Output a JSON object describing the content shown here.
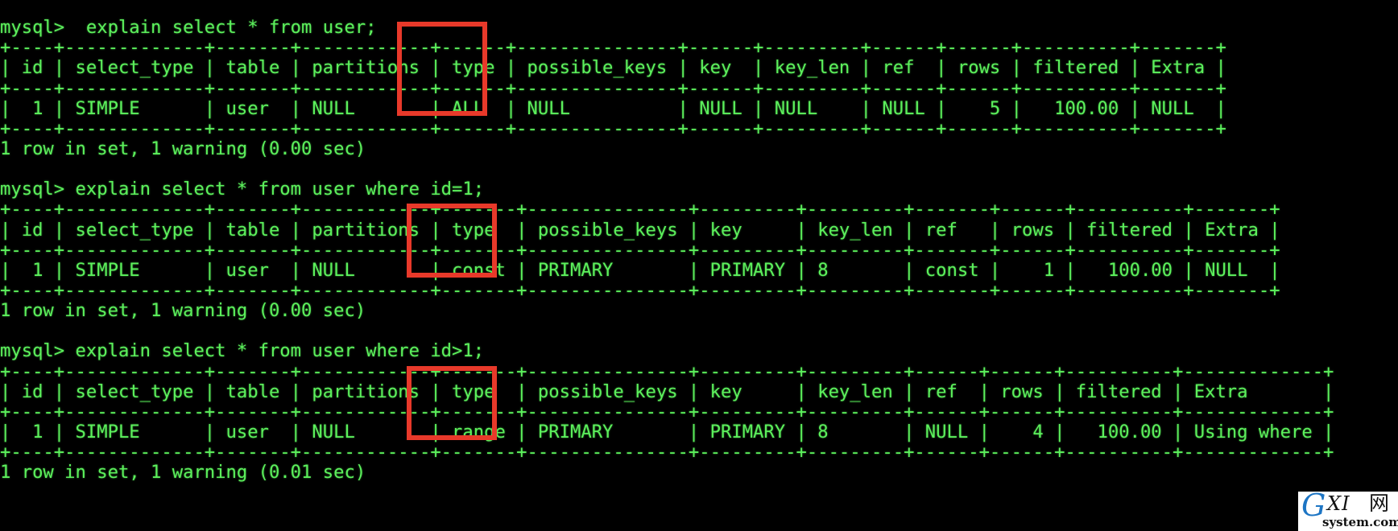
{
  "terminal": {
    "prompt": "mysql>",
    "foreground_color": "#5cf05c",
    "background_color": "#000000",
    "highlight_color": "#e8392a",
    "lines": [
      "mysql>  explain select * from user;",
      "+----+-------------+-------+------------+------+---------------+------+---------+------+------+----------+-------+",
      "| id | select_type | table | partitions | type | possible_keys | key  | key_len | ref  | rows | filtered | Extra |",
      "+----+-------------+-------+------------+------+---------------+------+---------+------+------+----------+-------+",
      "|  1 | SIMPLE      | user  | NULL       | ALL  | NULL          | NULL | NULL    | NULL |    5 |   100.00 | NULL  |",
      "+----+-------------+-------+------------+------+---------------+------+---------+------+------+----------+-------+",
      "1 row in set, 1 warning (0.00 sec)",
      "",
      "mysql> explain select * from user where id=1;",
      "+----+-------------+-------+------------+-------+---------------+---------+---------+-------+------+----------+-------+",
      "| id | select_type | table | partitions | type  | possible_keys | key     | key_len | ref   | rows | filtered | Extra |",
      "+----+-------------+-------+------------+-------+---------------+---------+---------+-------+------+----------+-------+",
      "|  1 | SIMPLE      | user  | NULL       | const | PRIMARY       | PRIMARY | 8       | const |    1 |   100.00 | NULL  |",
      "+----+-------------+-------+------------+-------+---------------+---------+---------+-------+------+----------+-------+",
      "1 row in set, 1 warning (0.00 sec)",
      "",
      "mysql> explain select * from user where id>1;",
      "+----+-------------+-------+------------+-------+---------------+---------+---------+------+------+----------+-------------+",
      "| id | select_type | table | partitions | type  | possible_keys | key     | key_len | ref  | rows | filtered | Extra       |",
      "+----+-------------+-------+------------+-------+---------------+---------+---------+------+------+----------+-------------+",
      "|  1 | SIMPLE      | user  | NULL       | range | PRIMARY       | PRIMARY | 8       | NULL |    4 |   100.00 | Using where |",
      "+----+-------------+-------+------------+-------+---------------+---------+---------+------+------+----------+-------------+",
      "1 row in set, 1 warning (0.01 sec)"
    ]
  },
  "queries": [
    {
      "command": "explain select * from user;",
      "columns": [
        "id",
        "select_type",
        "table",
        "partitions",
        "type",
        "possible_keys",
        "key",
        "key_len",
        "ref",
        "rows",
        "filtered",
        "Extra"
      ],
      "row": [
        "1",
        "SIMPLE",
        "user",
        "NULL",
        "ALL",
        "NULL",
        "NULL",
        "NULL",
        "NULL",
        "5",
        "100.00",
        "NULL"
      ],
      "result": "1 row in set, 1 warning (0.00 sec)",
      "highlighted_column": "type",
      "highlighted_value": "ALL"
    },
    {
      "command": "explain select * from user where id=1;",
      "columns": [
        "id",
        "select_type",
        "table",
        "partitions",
        "type",
        "possible_keys",
        "key",
        "key_len",
        "ref",
        "rows",
        "filtered",
        "Extra"
      ],
      "row": [
        "1",
        "SIMPLE",
        "user",
        "NULL",
        "const",
        "PRIMARY",
        "PRIMARY",
        "8",
        "const",
        "1",
        "100.00",
        "NULL"
      ],
      "result": "1 row in set, 1 warning (0.00 sec)",
      "highlighted_column": "type",
      "highlighted_value": "const"
    },
    {
      "command": "explain select * from user where id>1;",
      "columns": [
        "id",
        "select_type",
        "table",
        "partitions",
        "type",
        "possible_keys",
        "key",
        "key_len",
        "ref",
        "rows",
        "filtered",
        "Extra"
      ],
      "row": [
        "1",
        "SIMPLE",
        "user",
        "NULL",
        "range",
        "PRIMARY",
        "PRIMARY",
        "8",
        "NULL",
        "4",
        "100.00",
        "Using where"
      ],
      "result": "1 row in set, 1 warning (0.01 sec)",
      "highlighted_column": "type",
      "highlighted_value": "range"
    }
  ],
  "watermark": {
    "letter_g": "G",
    "letters_xi": "XI",
    "cjk": "网",
    "domain": "system.com",
    "g_color": "#1d75c4",
    "text_color": "#111111"
  }
}
